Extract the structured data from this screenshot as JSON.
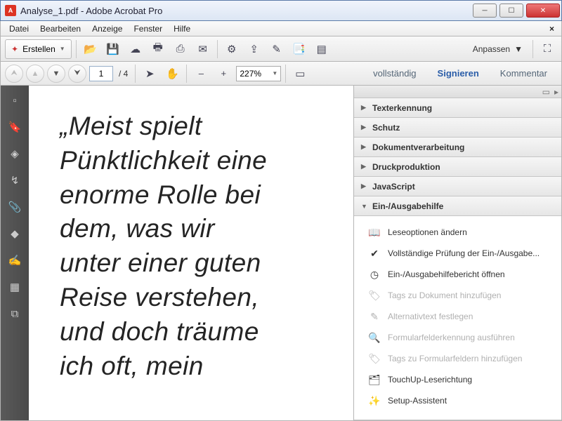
{
  "window": {
    "title": "Analyse_1.pdf - Adobe Acrobat Pro"
  },
  "menu": {
    "file": "Datei",
    "edit": "Bearbeiten",
    "view": "Anzeige",
    "window": "Fenster",
    "help": "Hilfe"
  },
  "toolbar": {
    "create": "Erstellen",
    "customize": "Anpassen"
  },
  "nav": {
    "page": "1",
    "pages": "/ 4",
    "zoom": "227%",
    "full": "vollständig",
    "sign": "Signieren",
    "comment": "Kommentar"
  },
  "doc": {
    "text": "„Meist spielt\n Pünktlichkeit eine\n enorme Rolle bei\n dem, was wir\n unter einer guten\n Reise verstehen,\n und doch träume\n ich oft, mein"
  },
  "panel": {
    "sections": {
      "text": "Texterkennung",
      "protect": "Schutz",
      "docproc": "Dokumentverarbeitung",
      "print": "Druckproduktion",
      "js": "JavaScript",
      "access": "Ein-/Ausgabehilfe"
    },
    "tools": {
      "t1": "Leseoptionen ändern",
      "t2": "Vollständige Prüfung der Ein-/Ausgabe...",
      "t3": "Ein-/Ausgabehilfebericht öffnen",
      "t4": "Tags zu Dokument hinzufügen",
      "t5": "Alternativtext festlegen",
      "t6": "Formularfelderkennung ausführen",
      "t7": "Tags zu Formularfeldern hinzufügen",
      "t8": "TouchUp-Leserichtung",
      "t9": "Setup-Assistent"
    }
  }
}
